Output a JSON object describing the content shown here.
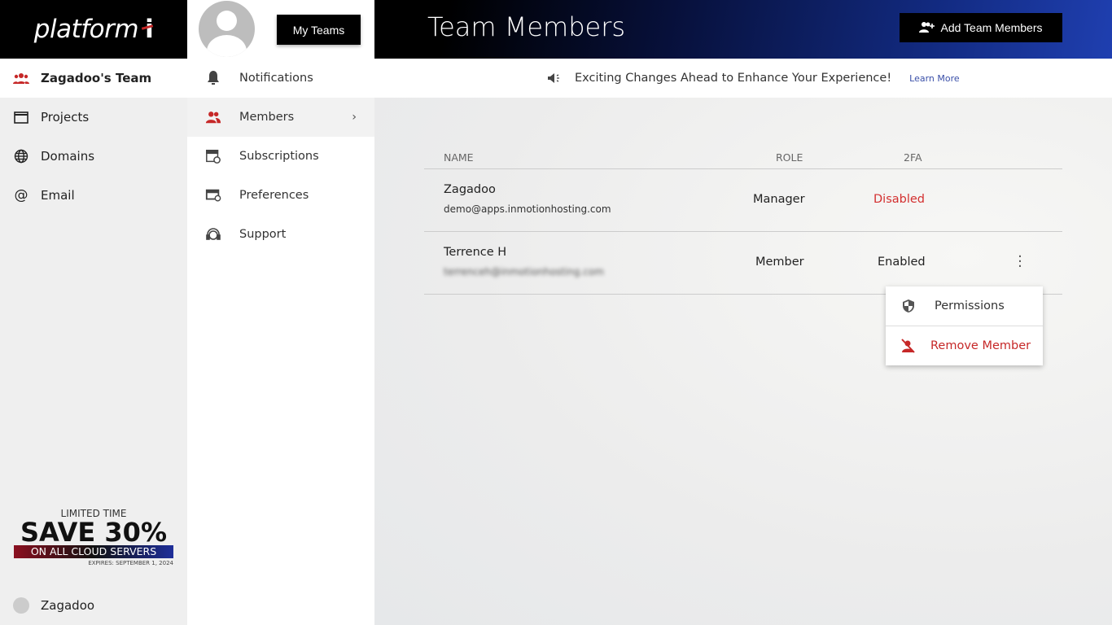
{
  "brand": {
    "logo": "platform i"
  },
  "left_nav": {
    "team": "Zagadoo's Team",
    "items": [
      {
        "label": "Projects"
      },
      {
        "label": "Domains"
      },
      {
        "label": "Email"
      }
    ]
  },
  "promo": {
    "line1": "LIMITED TIME",
    "line2": "SAVE 30%",
    "line3": "ON ALL CLOUD SERVERS",
    "line4": "EXPIRES: SEPTEMBER 1, 2024"
  },
  "user": {
    "name": "Zagadoo"
  },
  "mid_nav": {
    "my_teams": "My Teams",
    "items": [
      {
        "label": "Notifications"
      },
      {
        "label": "Members"
      },
      {
        "label": "Subscriptions"
      },
      {
        "label": "Preferences"
      },
      {
        "label": "Support"
      }
    ]
  },
  "header": {
    "title": "Team Members",
    "add_button": "Add Team Members"
  },
  "announcement": {
    "text": "Exciting Changes Ahead to Enhance Your Experience!",
    "link": "Learn More"
  },
  "table": {
    "headers": {
      "name": "NAME",
      "role": "ROLE",
      "twofa": "2FA"
    },
    "rows": [
      {
        "name": "Zagadoo",
        "email": "demo@apps.inmotionhosting.com",
        "role": "Manager",
        "twofa": "Disabled"
      },
      {
        "name": "Terrence H",
        "email": "terrenceh@inmotionhosting.com",
        "role": "Member",
        "twofa": "Enabled"
      }
    ]
  },
  "dropdown": {
    "items": [
      {
        "label": "Permissions"
      },
      {
        "label": "Remove Member"
      }
    ]
  },
  "colors": {
    "accent": "#c62828",
    "disabled": "#d32f2f",
    "link": "#3a4fa8"
  }
}
